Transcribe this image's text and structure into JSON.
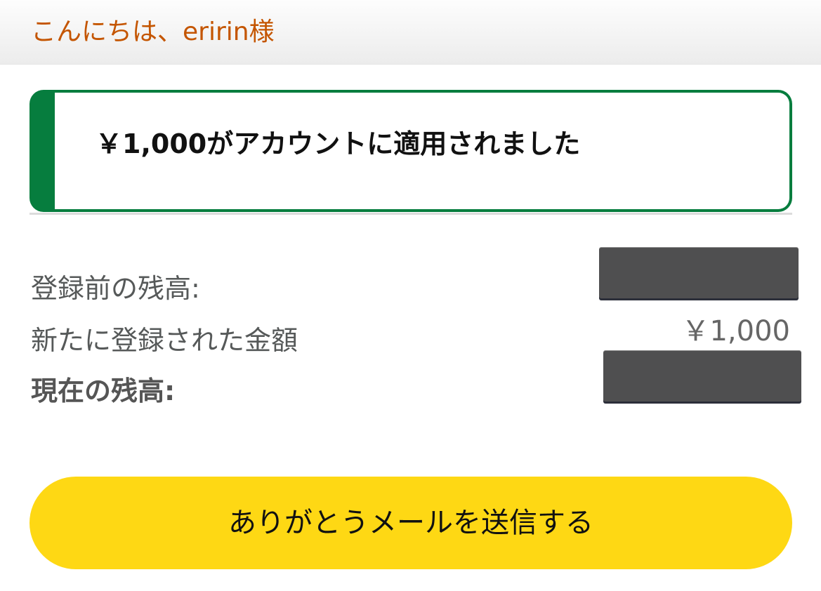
{
  "header": {
    "greeting": "こんにちは、eririn様"
  },
  "alert": {
    "message": "￥1,000がアカウントに適用されました",
    "accent_color": "#067d3e"
  },
  "balance": {
    "rows": [
      {
        "label": "登録前の残高:",
        "value": ""
      },
      {
        "label": "新たに登録された金額",
        "value": "￥1,000"
      },
      {
        "label": "現在の残高:",
        "value": ""
      }
    ]
  },
  "cta": {
    "label": "ありがとうメールを送信する",
    "color": "#fed814"
  }
}
